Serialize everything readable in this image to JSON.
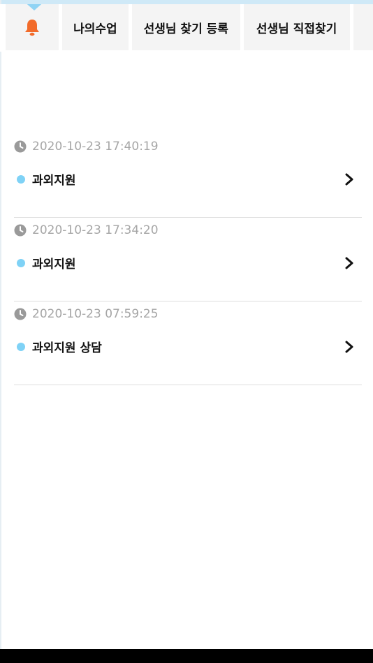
{
  "tabs": [
    {
      "label": ""
    },
    {
      "label": "나의수업"
    },
    {
      "label": "선생님 찾기 등록"
    },
    {
      "label": "선생님 직접찾기"
    }
  ],
  "colors": {
    "bell": "#f26b2a",
    "accent": "#7fd2f6",
    "timestamp": "#a6a6a6"
  },
  "notifications": [
    {
      "timestamp": "2020-10-23 17:40:19",
      "title": "과외지원"
    },
    {
      "timestamp": "2020-10-23 17:34:20",
      "title": "과외지원"
    },
    {
      "timestamp": "2020-10-23 07:59:25",
      "title": "과외지원 상담"
    }
  ]
}
